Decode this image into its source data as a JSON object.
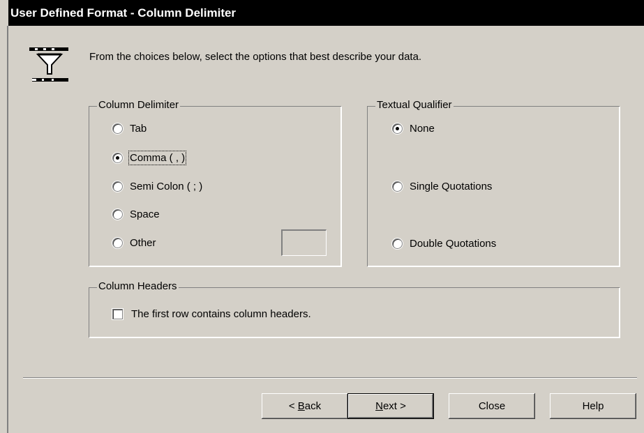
{
  "window": {
    "title": "User Defined Format - Column Delimiter"
  },
  "instruction": "From the choices below, select the options that best describe your data.",
  "column_delimiter": {
    "label": "Column Delimiter",
    "options": [
      {
        "label": "Tab",
        "selected": false
      },
      {
        "label": "Comma ( , )",
        "selected": true
      },
      {
        "label": "Semi Colon ( ; )",
        "selected": false
      },
      {
        "label": "Space",
        "selected": false
      },
      {
        "label": "Other",
        "selected": false
      }
    ],
    "other_value": ""
  },
  "textual_qualifier": {
    "label": "Textual Qualifier",
    "options": [
      {
        "label": "None",
        "selected": true
      },
      {
        "label": "Single Quotations",
        "selected": false
      },
      {
        "label": "Double Quotations",
        "selected": false
      }
    ]
  },
  "column_headers": {
    "label": "Column Headers",
    "checkbox_label": "The first row contains column headers.",
    "checked": false
  },
  "buttons": {
    "back_mnemonic": "B",
    "back_rest": "ack",
    "back_prefix": "< ",
    "next_mnemonic": "N",
    "next_rest": "ext >",
    "close": "Close",
    "help": "Help"
  }
}
